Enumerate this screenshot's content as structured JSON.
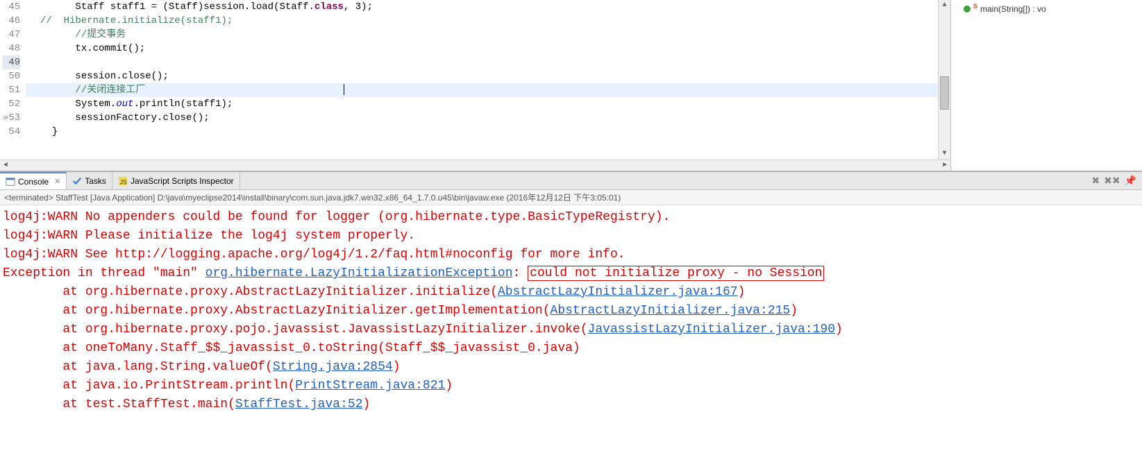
{
  "editor": {
    "lines": [
      {
        "num": 45,
        "segments": [
          {
            "t": "        Staff staff1 = (Staff)session.load(Staff."
          },
          {
            "t": "class",
            "cls": "kw"
          },
          {
            "t": ", 3);"
          }
        ]
      },
      {
        "num": 46,
        "segments": [
          {
            "t": "  //  Hibernate.initialize(staff1);",
            "cls": "cmt"
          }
        ]
      },
      {
        "num": 47,
        "segments": [
          {
            "t": "        //提交事务",
            "cls": "cmt"
          }
        ]
      },
      {
        "num": 48,
        "segments": [
          {
            "t": "        tx.commit();"
          }
        ]
      },
      {
        "num": 49,
        "hlGutter": true,
        "segments": [
          {
            "t": ""
          }
        ]
      },
      {
        "num": 50,
        "segments": [
          {
            "t": "        session.close();"
          }
        ]
      },
      {
        "num": 51,
        "current": true,
        "segments": [
          {
            "t": "        //关闭连接工厂",
            "cls": "cmt"
          }
        ]
      },
      {
        "num": 52,
        "segments": [
          {
            "t": "        System."
          },
          {
            "t": "out",
            "cls": "fld"
          },
          {
            "t": ".println(staff1);"
          }
        ]
      },
      {
        "num": 53,
        "marker": "»",
        "segments": [
          {
            "t": "        sessionFactory.close();"
          }
        ]
      },
      {
        "num": 54,
        "segments": [
          {
            "t": "    }"
          }
        ]
      }
    ]
  },
  "outline": {
    "method": "main(String[]) : vo",
    "supMark": "S"
  },
  "tabs": {
    "console": "Console",
    "tasks": "Tasks",
    "js": "JavaScript Scripts Inspector"
  },
  "terminated": "<terminated> StaffTest [Java Application] D:\\java\\myeclipse2014\\install\\binary\\com.sun.java.jdk7.win32.x86_64_1.7.0.u45\\bin\\javaw.exe (2016年12月12日 下午3:05:01)",
  "console": {
    "l1": "log4j:WARN No appenders could be found for logger (org.hibernate.type.BasicTypeRegistry).",
    "l2": "log4j:WARN Please initialize the log4j system properly.",
    "l3": "log4j:WARN See http://logging.apache.org/log4j/1.2/faq.html#noconfig for more info.",
    "l4a": "Exception in thread \"main\" ",
    "l4b": "org.hibernate.LazyInitializationException",
    "l4c": ": ",
    "l4d": "could not initialize proxy - no Session",
    "l5a": "        at org.hibernate.proxy.AbstractLazyInitializer.initialize(",
    "l5b": "AbstractLazyInitializer.java:167",
    "l5c": ")",
    "l6a": "        at org.hibernate.proxy.AbstractLazyInitializer.getImplementation(",
    "l6b": "AbstractLazyInitializer.java:215",
    "l6c": ")",
    "l7a": "        at org.hibernate.proxy.pojo.javassist.JavassistLazyInitializer.invoke(",
    "l7b": "JavassistLazyInitializer.java:190",
    "l7c": ")",
    "l8": "        at oneToMany.Staff_$$_javassist_0.toString(Staff_$$_javassist_0.java)",
    "l9a": "        at java.lang.String.valueOf(",
    "l9b": "String.java:2854",
    "l9c": ")",
    "l10a": "        at java.io.PrintStream.println(",
    "l10b": "PrintStream.java:821",
    "l10c": ")",
    "l11a": "        at test.StaffTest.main(",
    "l11b": "StaffTest.java:52",
    "l11c": ")"
  }
}
